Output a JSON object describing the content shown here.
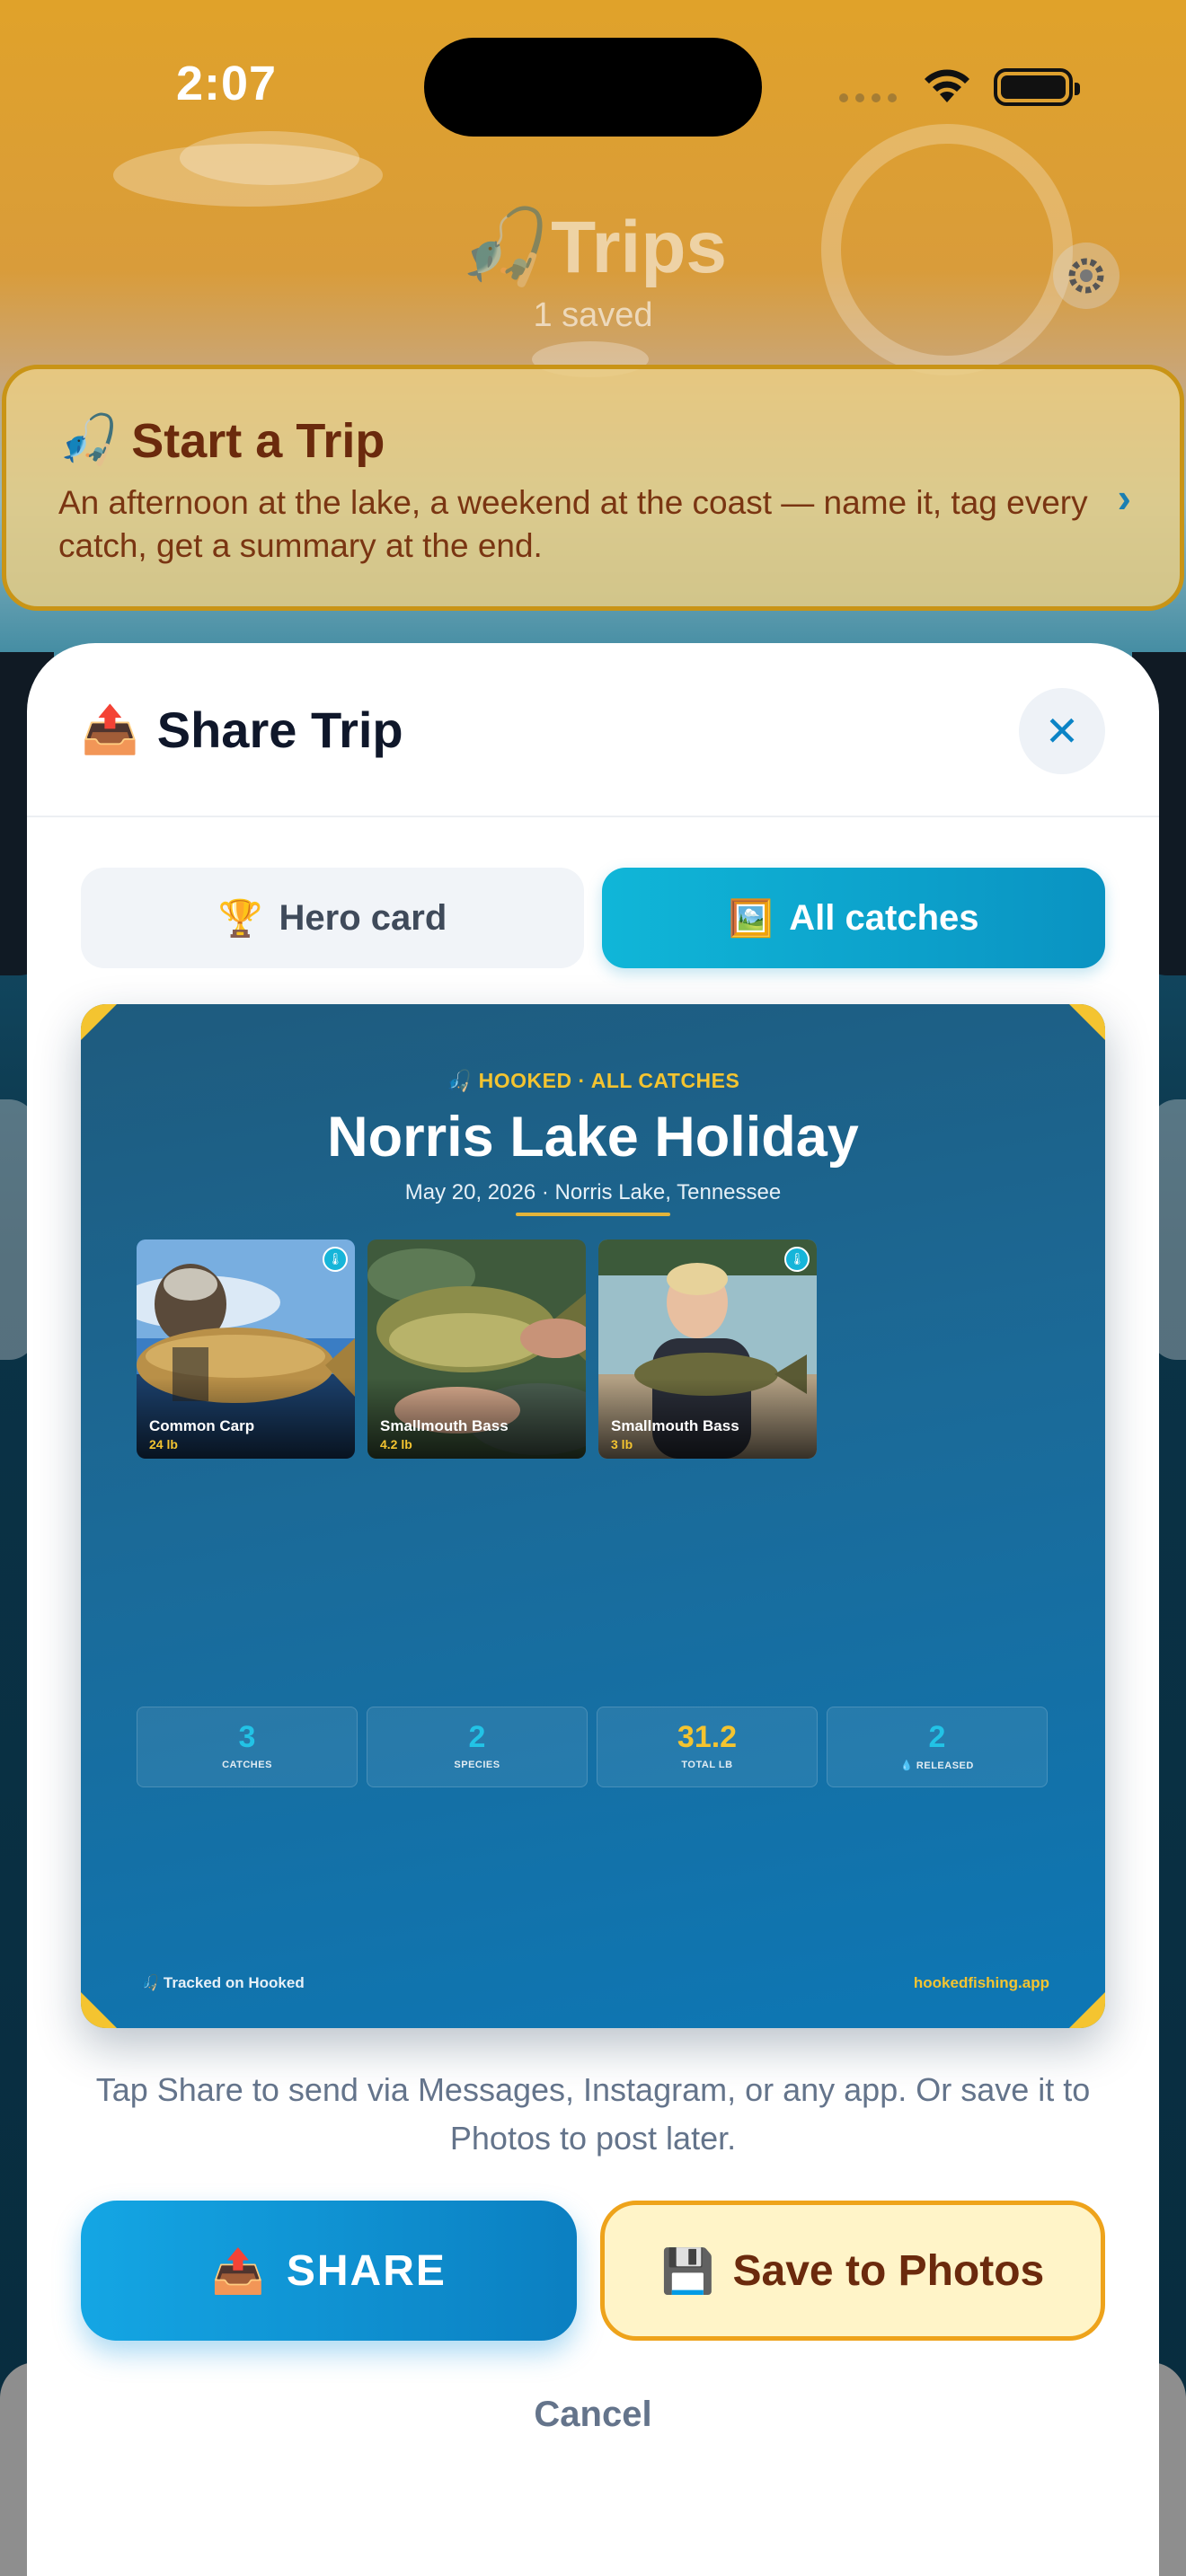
{
  "status_bar": {
    "time": "2:07"
  },
  "background": {
    "title": "Trips",
    "subtitle": "1 saved",
    "start_card": {
      "title": "Start a Trip",
      "description": "An afternoon at the lake, a weekend at the coast — name it, tag every catch, get a summary at the end."
    }
  },
  "sheet": {
    "title": "Share Trip",
    "tabs": [
      {
        "label": "Hero card",
        "icon": "trophy-icon",
        "active": false
      },
      {
        "label": "All catches",
        "icon": "picture-icon",
        "active": true
      }
    ],
    "card": {
      "brand": "HOOKED",
      "brand_suffix": "ALL CATCHES",
      "trip_name": "Norris Lake Holiday",
      "date": "May 20, 2026",
      "location": "Norris Lake, Tennessee",
      "catches": [
        {
          "species": "Common Carp",
          "weight": "24 lb",
          "released": true
        },
        {
          "species": "Smallmouth Bass",
          "weight": "4.2 lb",
          "released": false
        },
        {
          "species": "Smallmouth Bass",
          "weight": "3 lb",
          "released": true
        }
      ],
      "stats": [
        {
          "value": "3",
          "label": "CATCHES"
        },
        {
          "value": "2",
          "label": "SPECIES"
        },
        {
          "value": "31.2",
          "label": "TOTAL LB"
        },
        {
          "value": "2",
          "label": "RELEASED"
        }
      ],
      "footer_left": "Tracked on Hooked",
      "footer_right": "hookedfishing.app"
    },
    "helper_text": "Tap Share to send via Messages, Instagram, or any app. Or save it to Photos to post later.",
    "share_label": "SHARE",
    "save_label": "Save to Photos",
    "cancel_label": "Cancel",
    "colors": {
      "accent": "#0b93c2",
      "gold": "#f4c430",
      "save_border": "#eea31b"
    }
  }
}
